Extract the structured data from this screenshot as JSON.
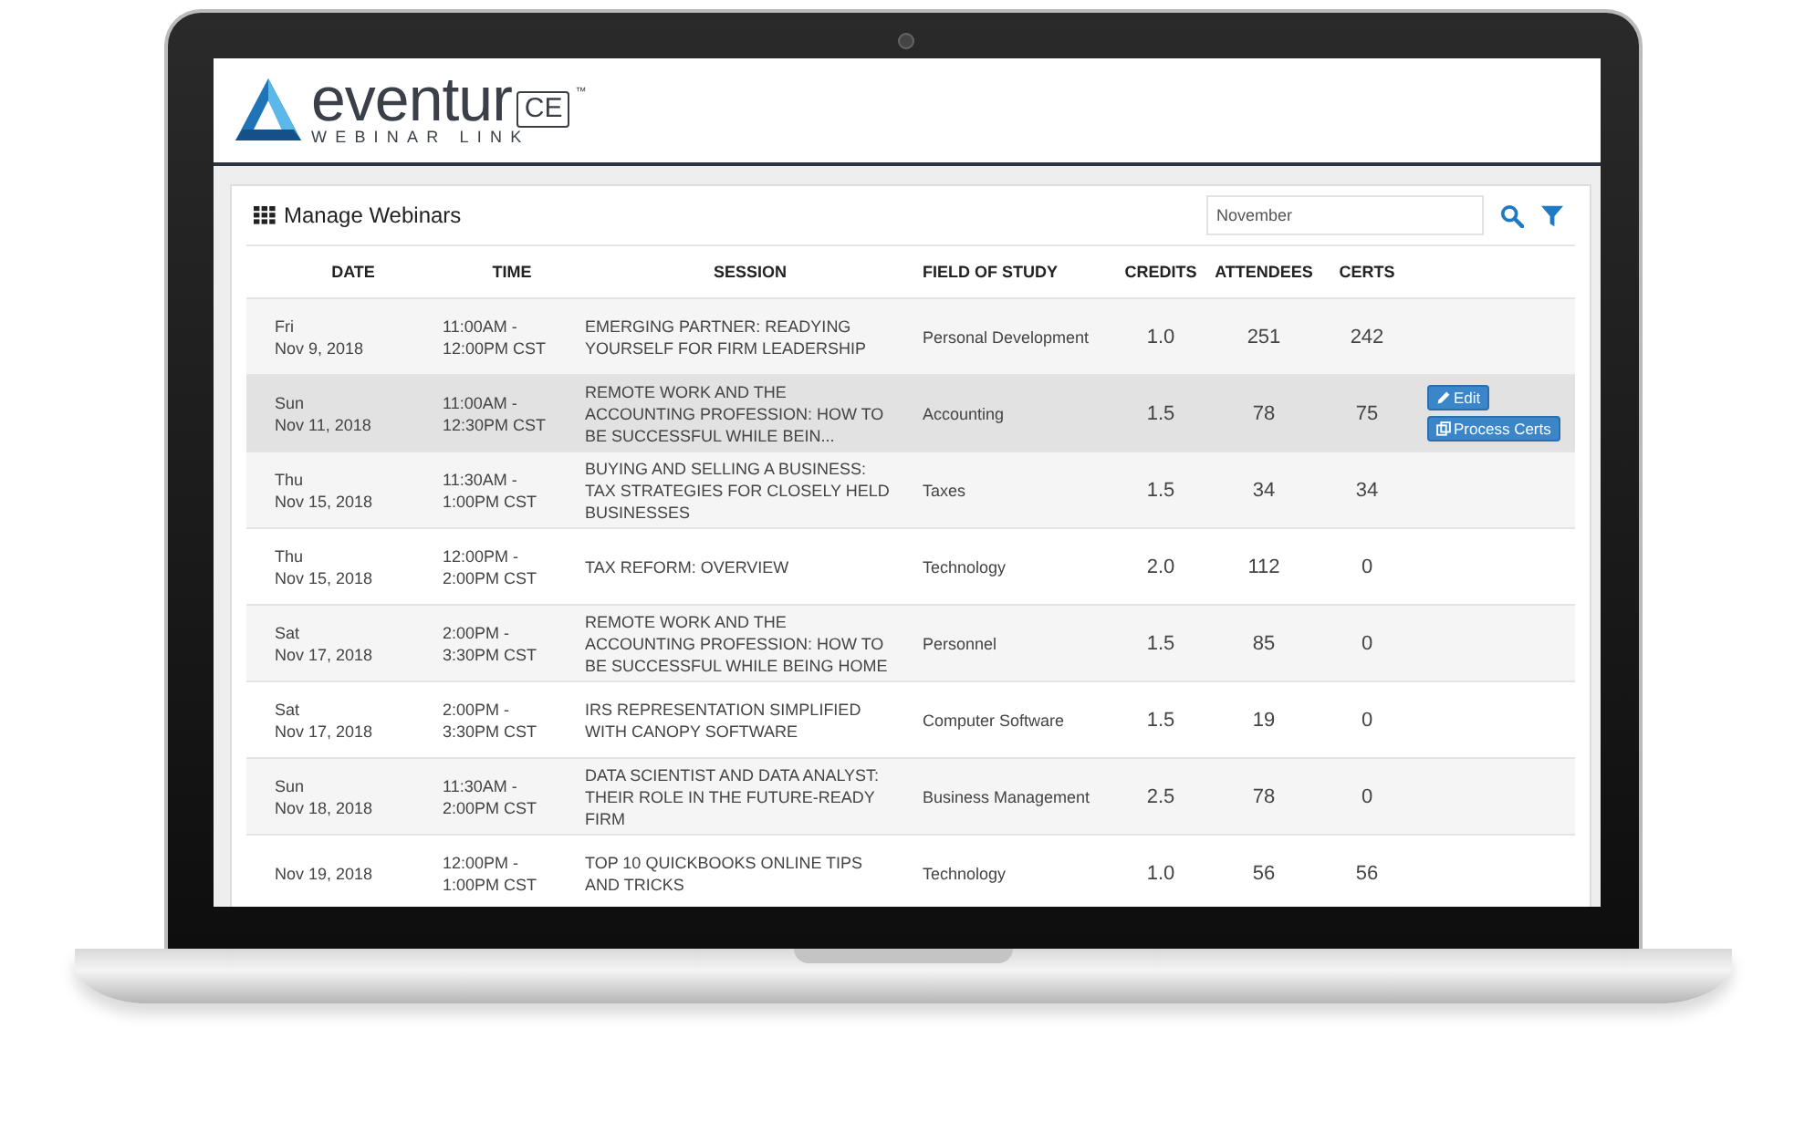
{
  "logo": {
    "word": "eventur",
    "badge": "CE",
    "trademark": "™",
    "tagline": "WEBINAR LINK"
  },
  "panel": {
    "title": "Manage Webinars",
    "search": {
      "value": "November"
    }
  },
  "table": {
    "columns": [
      "DATE",
      "TIME",
      "SESSION",
      "FIELD OF STUDY",
      "CREDITS",
      "ATTENDEES",
      "CERTS"
    ],
    "rows": [
      {
        "day": "Fri",
        "date": "Nov 9, 2018",
        "time": "11:00AM - 12:00PM CST",
        "session": "EMERGING PARTNER: READYING YOURSELF FOR FIRM LEADERSHIP",
        "field": "Personal Development",
        "credits": "1.0",
        "attendees": "251",
        "certs": "242",
        "selected": false
      },
      {
        "day": "Sun",
        "date": "Nov 11, 2018",
        "time": "11:00AM - 12:30PM CST",
        "session": "REMOTE WORK AND THE ACCOUNTING PROFESSION: HOW TO BE SUCCESSFUL WHILE BEIN...",
        "field": "Accounting",
        "credits": "1.5",
        "attendees": "78",
        "certs": "75",
        "selected": true,
        "actions": [
          {
            "kind": "edit",
            "label": "Edit"
          },
          {
            "kind": "certs",
            "label": "Process Certs"
          }
        ]
      },
      {
        "day": "Thu",
        "date": "Nov 15, 2018",
        "time": "11:30AM - 1:00PM CST",
        "session": "BUYING AND SELLING A BUSINESS: TAX STRATEGIES FOR CLOSELY HELD BUSINESSES",
        "field": "Taxes",
        "credits": "1.5",
        "attendees": "34",
        "certs": "34",
        "selected": false
      },
      {
        "day": "Thu",
        "date": "Nov 15, 2018",
        "time": "12:00PM - 2:00PM CST",
        "session": "TAX REFORM: OVERVIEW",
        "field": "Technology",
        "credits": "2.0",
        "attendees": "112",
        "certs": "0",
        "selected": false
      },
      {
        "day": "Sat",
        "date": "Nov 17, 2018",
        "time": "2:00PM - 3:30PM CST",
        "session": "REMOTE WORK AND THE ACCOUNTING PROFESSION: HOW TO BE SUCCESSFUL WHILE BEING HOME",
        "field": "Personnel",
        "credits": "1.5",
        "attendees": "85",
        "certs": "0",
        "selected": false
      },
      {
        "day": "Sat",
        "date": "Nov 17, 2018",
        "time": "2:00PM - 3:30PM CST",
        "session": "IRS REPRESENTATION SIMPLIFIED WITH CANOPY SOFTWARE",
        "field": "Computer Software",
        "credits": "1.5",
        "attendees": "19",
        "certs": "0",
        "selected": false
      },
      {
        "day": "Sun",
        "date": "Nov 18, 2018",
        "time": "11:30AM - 2:00PM CST",
        "session": "DATA SCIENTIST AND DATA ANALYST: THEIR ROLE IN THE FUTURE-READY FIRM",
        "field": "Business Management",
        "credits": "2.5",
        "attendees": "78",
        "certs": "0",
        "selected": false
      },
      {
        "date": "Nov 19, 2018",
        "time": "12:00PM - 1:00PM CST",
        "session": "TOP 10 QUICKBOOKS ONLINE TIPS AND TRICKS",
        "field": "Technology",
        "credits": "1.0",
        "attendees": "56",
        "certs": "56",
        "selected": false
      }
    ]
  }
}
